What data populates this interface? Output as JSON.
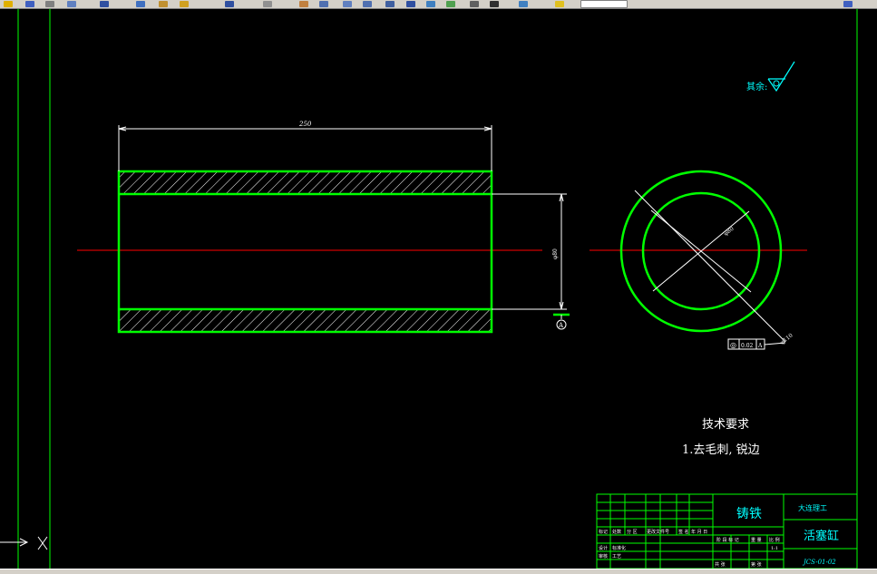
{
  "toolbar": {
    "icons": [
      "open-icon",
      "save-icon",
      "print-icon",
      "preview-icon",
      "cut-icon",
      "copy-icon",
      "paste-icon",
      "match-icon",
      "undo-icon",
      "redo-icon",
      "pan-icon",
      "zoom-icon",
      "zoom-window-icon",
      "zoom-previous-icon",
      "properties-icon",
      "design-center-icon",
      "tool-palette-icon",
      "sheet-set-icon",
      "markup-icon",
      "calculator-icon",
      "layer-icon",
      "layer-state-icon"
    ]
  },
  "drawing": {
    "surface_finish_label": "其余:",
    "length_dimension": "250",
    "diameter_dimension": "φ80",
    "circle_inner_dimension": "φ80",
    "circle_outer_dimension": "φ110",
    "datum_label": "A",
    "tolerance_symbol": "◎",
    "tolerance_value": "0.02",
    "tolerance_datum": "A",
    "tech_title": "技术要求",
    "tech_item": "1.去毛刺, 锐边",
    "colors": {
      "outline": "#00ff00",
      "center_line": "#ff0000",
      "dimension": "#ffffff",
      "text": "#ffffff",
      "annotation": "#00ffff",
      "frame": "#00ff00"
    }
  },
  "title_block": {
    "material": "铸铁",
    "school": "大连理工",
    "part_name": "活塞缸",
    "drawing_no": "JCS-01-02",
    "scale": "1:1",
    "row_labels": [
      "标记",
      "处数",
      "分 区",
      "更改文件号",
      "签 名",
      "年 月 日"
    ],
    "row2_labels": [
      "设计",
      "标准化",
      "阶 段 标 记",
      "重 量",
      "比 例"
    ],
    "row3_labels": [
      "审核",
      "工艺",
      "共 张",
      "第 张"
    ]
  }
}
